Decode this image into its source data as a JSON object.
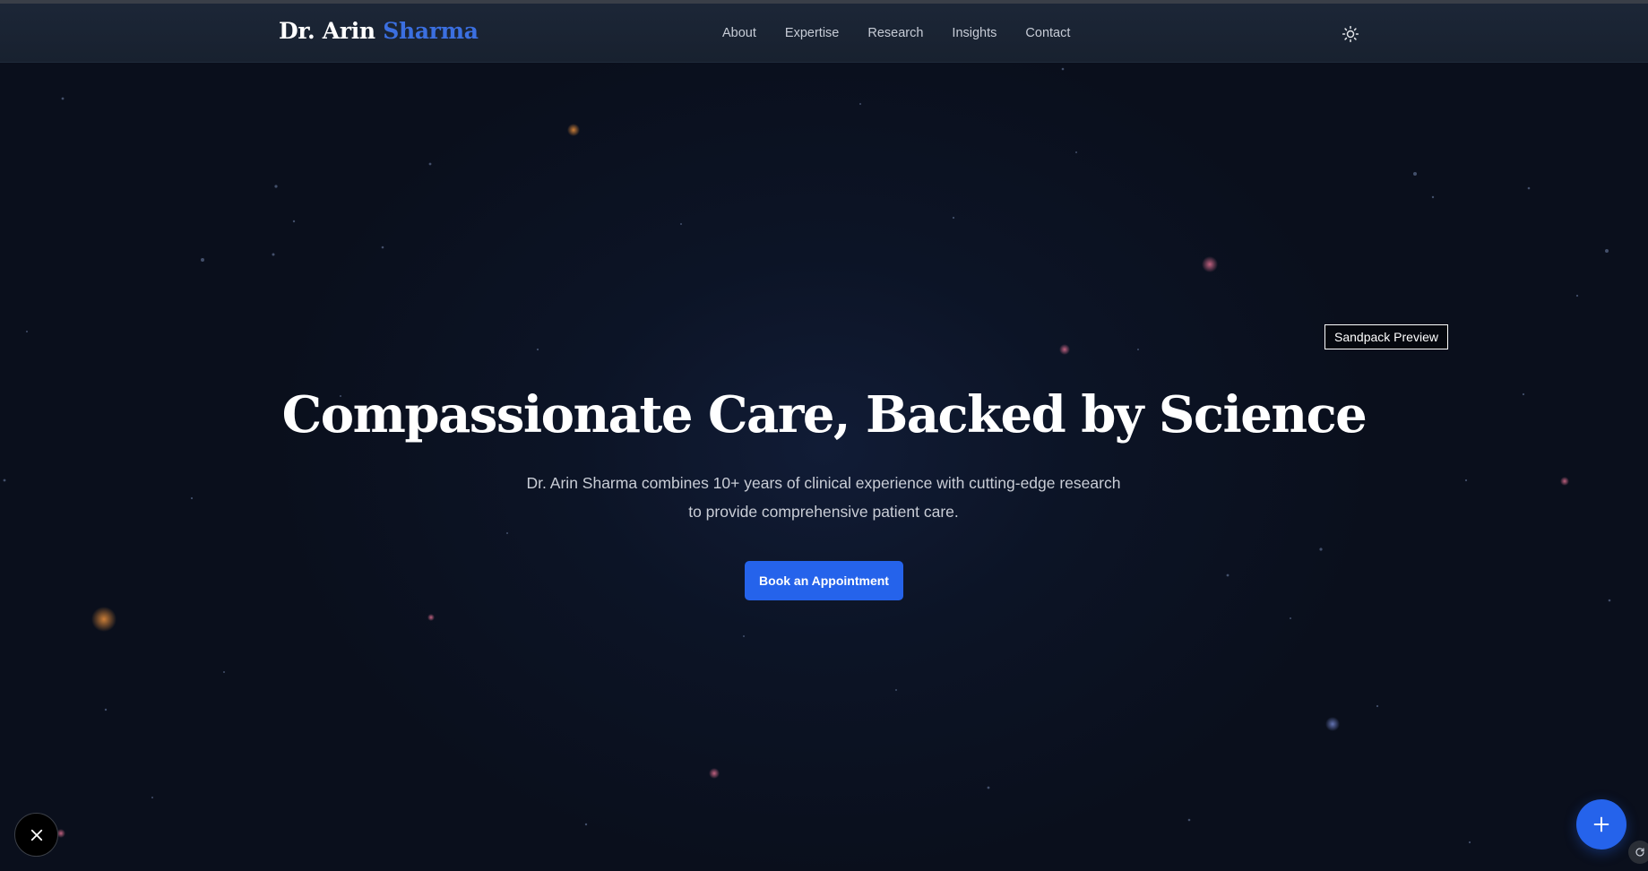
{
  "header": {
    "brand_first": "Dr. Arin",
    "brand_accent": "Sharma",
    "nav": [
      {
        "label": "About"
      },
      {
        "label": "Expertise"
      },
      {
        "label": "Research"
      },
      {
        "label": "Insights"
      },
      {
        "label": "Contact"
      }
    ],
    "theme_toggle_icon": "sun-icon"
  },
  "hero": {
    "title": "Compassionate Care, Backed by Science",
    "subtitle_line1": "Dr. Arin Sharma combines 10+ years of clinical experience with cutting-edge research",
    "subtitle_line2": "to provide comprehensive patient care.",
    "cta_label": "Book an Appointment"
  },
  "overlay": {
    "sandpack_label": "Sandpack Preview",
    "close_icon": "close-icon",
    "fab_icon": "plus-icon",
    "refresh_icon": "refresh-icon"
  },
  "colors": {
    "accent": "#2563eb",
    "brand_accent": "#3b6fe0",
    "background": "#0a0f1c",
    "navbar": "#1c2637"
  }
}
